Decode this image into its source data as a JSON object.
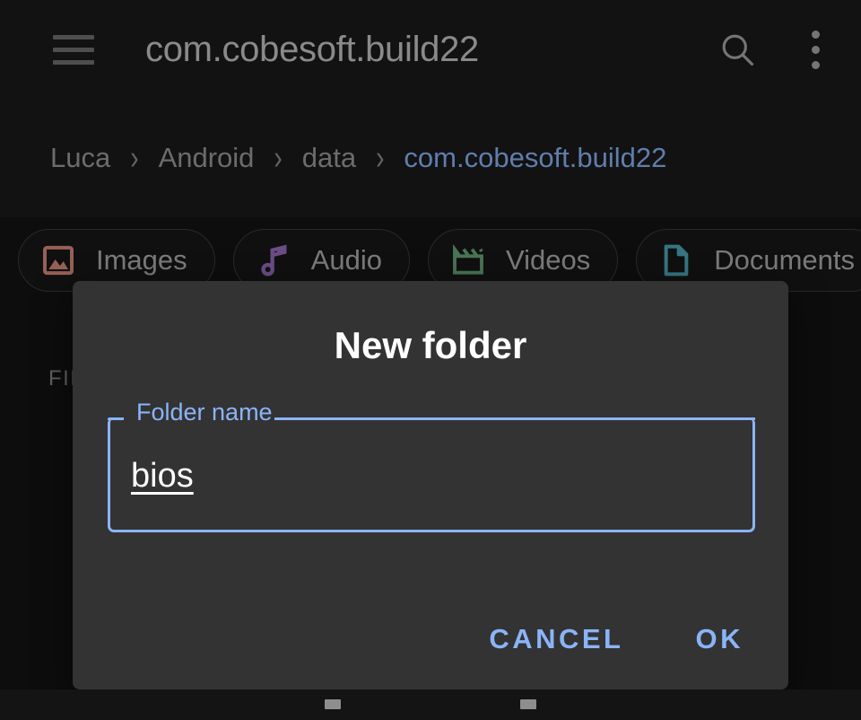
{
  "appbar": {
    "title": "com.cobesoft.build22",
    "menu_icon": "hamburger-menu-icon",
    "search_icon": "search-icon",
    "overflow_icon": "more-vert-icon"
  },
  "breadcrumb": {
    "separator": "›",
    "items": [
      {
        "label": "Luca",
        "current": false
      },
      {
        "label": "Android",
        "current": false
      },
      {
        "label": "data",
        "current": false
      },
      {
        "label": "com.cobesoft.build22",
        "current": true
      }
    ]
  },
  "chips": [
    {
      "label": "Images",
      "icon": "image-icon",
      "color": "#d98a7c"
    },
    {
      "label": "Audio",
      "icon": "music-note-icon",
      "color": "#9a6fc0"
    },
    {
      "label": "Videos",
      "icon": "movie-clapper-icon",
      "color": "#6aa87a"
    },
    {
      "label": "Documents",
      "icon": "document-icon",
      "color": "#4fa8bd"
    }
  ],
  "content": {
    "files_section_label": "FILES"
  },
  "dialog": {
    "title": "New folder",
    "field": {
      "label": "Folder name",
      "value": "bios",
      "placeholder": ""
    },
    "buttons": {
      "cancel": "CANCEL",
      "ok": "OK"
    }
  },
  "colors": {
    "accent": "#8ab4f8",
    "dialog_bg": "#333333",
    "app_bg": "#141414",
    "appbar_bg": "#1a1a1a",
    "title_text": "#c6c6c6",
    "chip_text": "#b0b0b0"
  },
  "navbar": {
    "keys": [
      "nav-key-left",
      "nav-key-right"
    ]
  }
}
